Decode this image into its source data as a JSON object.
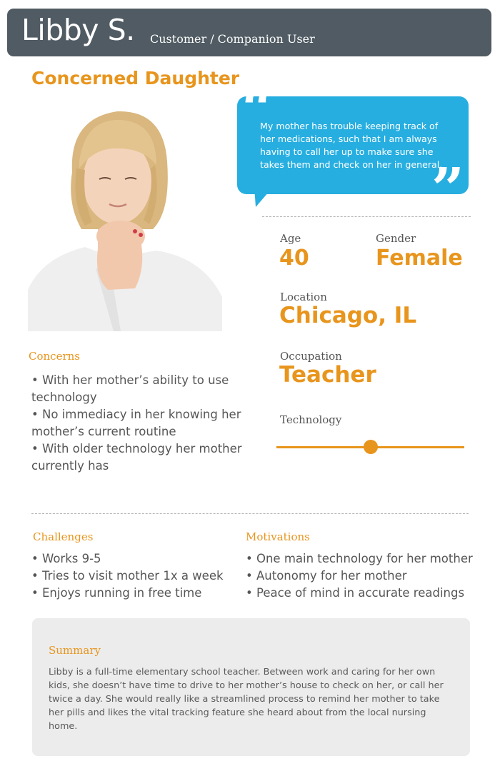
{
  "header": {
    "name": "Libby S.",
    "role": "Customer / Companion User"
  },
  "persona_title": "Concerned Daughter",
  "quote": {
    "text": "My mother has trouble keeping track of her medications, such that I am always having to call her up to make sure she takes them and check on her in general."
  },
  "demographics": {
    "age_label": "Age",
    "age_value": "40",
    "gender_label": "Gender",
    "gender_value": "Female",
    "location_label": "Location",
    "location_value": "Chicago, IL",
    "occupation_label": "Occupation",
    "occupation_value": "Teacher",
    "technology_label": "Technology",
    "technology_level": 0.5
  },
  "concerns": {
    "heading": "Concerns",
    "lines": [
      "• With her mother’s ability to use",
      "  technology",
      "• No immediacy in her knowing her",
      "  mother’s current routine",
      "• With older technology her mother",
      "currently has"
    ]
  },
  "challenges": {
    "heading": "Challenges",
    "items": [
      "• Works 9-5",
      "• Tries to visit mother 1x a week",
      "• Enjoys running in free time"
    ]
  },
  "motivations": {
    "heading": "Motivations",
    "items": [
      "• One main technology for her mother",
      "• Autonomy for her mother",
      "• Peace of mind in accurate readings"
    ]
  },
  "summary": {
    "heading": "Summary",
    "text": "Libby is a full-time elementary school teacher.  Between work and caring for her own kids, she doesn’t have time to drive to her mother’s house to check on her, or call her twice a day.  She would really like a streamlined process to remind her mother to take her pills and likes the vital tracking feature she heard about from the local nursing home."
  },
  "colors": {
    "accent": "#e8951d",
    "header_bg": "#505b63",
    "quote_bg": "#27aee0",
    "summary_bg": "#ececec"
  }
}
